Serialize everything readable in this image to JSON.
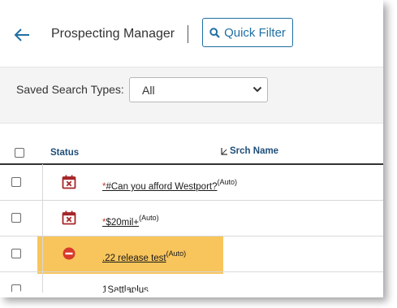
{
  "header": {
    "title": "Prospecting Manager",
    "quick_filter_label": "Quick Filter"
  },
  "filter": {
    "label": "Saved Search Types:",
    "selected": "All"
  },
  "table": {
    "columns": {
      "status": "Status",
      "name": "Srch Name"
    },
    "rows": [
      {
        "prefix": "*",
        "name": "#Can you afford Westport?",
        "suffix": "(Auto)",
        "status_icon": "calendar-x-icon"
      },
      {
        "prefix": "*",
        "name": "$20mil+",
        "suffix": "(Auto)",
        "status_icon": "calendar-x-icon"
      },
      {
        "prefix": "",
        "name": ".22 release test",
        "suffix": "(Auto)",
        "status_icon": "no-entry-icon"
      },
      {
        "prefix": "",
        "name": "1Sattlaplus",
        "suffix": "",
        "status_icon": ""
      }
    ]
  },
  "colors": {
    "accent": "#1f6fa3",
    "status_red": "#a5262a",
    "highlight": "#f8c55c"
  }
}
